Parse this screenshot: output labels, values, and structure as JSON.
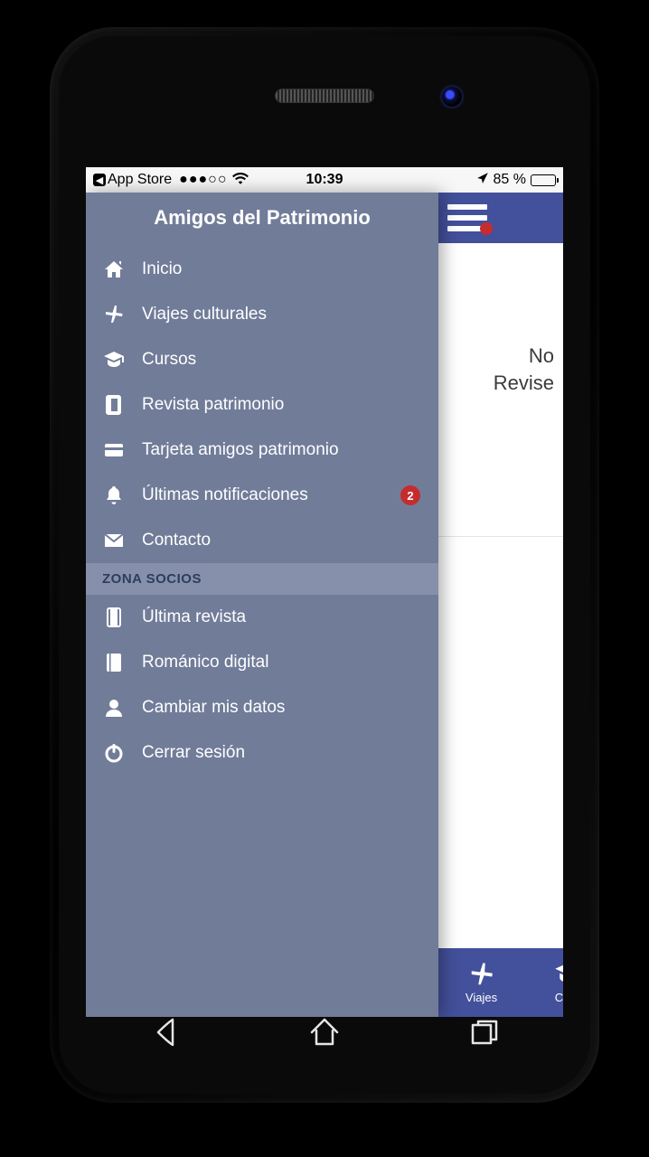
{
  "status": {
    "back_label": "App Store",
    "time": "10:39",
    "battery_pct": "85 %"
  },
  "drawer": {
    "title": "Amigos del Patrimonio",
    "items": [
      {
        "icon": "home",
        "label": "Inicio"
      },
      {
        "icon": "plane",
        "label": "Viajes culturales"
      },
      {
        "icon": "gradcap",
        "label": "Cursos"
      },
      {
        "icon": "book",
        "label": "Revista patrimonio"
      },
      {
        "icon": "card",
        "label": "Tarjeta amigos patrimonio"
      },
      {
        "icon": "bell",
        "label": "Últimas notificaciones",
        "badge": "2"
      },
      {
        "icon": "mail",
        "label": "Contacto"
      }
    ],
    "section_label": "ZONA SOCIOS",
    "member_items": [
      {
        "icon": "bookmark",
        "label": "Última revista"
      },
      {
        "icon": "bookfill",
        "label": "Románico digital"
      },
      {
        "icon": "user",
        "label": "Cambiar mis datos"
      },
      {
        "icon": "power",
        "label": "Cerrar sesión"
      }
    ]
  },
  "main": {
    "line1": "No",
    "line2": "Revise"
  },
  "tabs": [
    {
      "icon": "plane",
      "label": "Viajes"
    },
    {
      "icon": "gradcap",
      "label": "Curs"
    }
  ]
}
